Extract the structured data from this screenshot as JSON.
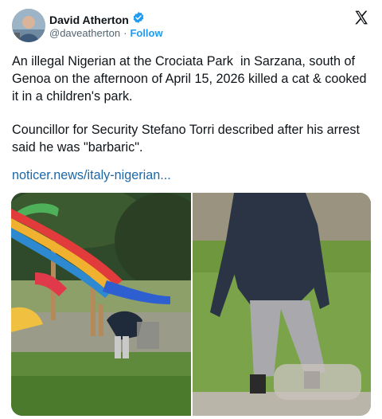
{
  "author": {
    "name": "David Atherton",
    "handle": "@daveatherton",
    "separator": "·",
    "follow_label": "Follow"
  },
  "tweet": {
    "paragraph_1": "An illegal Nigerian at the Crociata Park  in Sarzana, south of Genoa on the afternoon of April 15, 2026 killed a cat & cooked it in a children's park.",
    "paragraph_2": "Councillor for Security Stefano Torri described after his arrest said he was \"barbaric\".",
    "link_text": "noticer.news/italy-nigerian..."
  },
  "icons": {
    "verified": "verified-badge-icon",
    "platform": "x-logo-icon"
  },
  "colors": {
    "accent": "#1d9bf0",
    "link": "#1d67a8",
    "text": "#0f1419",
    "muted": "#536471"
  }
}
